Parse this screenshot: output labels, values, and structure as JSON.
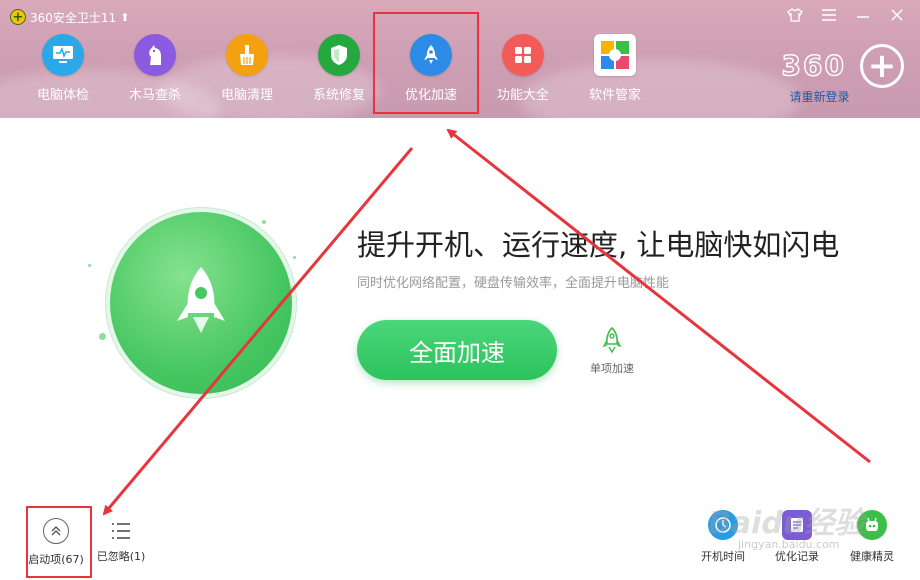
{
  "app": {
    "title": "360安全卫士11",
    "upgrade_icon": "arrow-up-icon"
  },
  "window_controls": [
    {
      "name": "skin",
      "icon": "shirt-icon"
    },
    {
      "name": "menu",
      "icon": "menu-icon"
    },
    {
      "name": "minimize",
      "icon": "minimize-icon"
    },
    {
      "name": "close",
      "icon": "close-icon"
    }
  ],
  "nav": {
    "items": [
      {
        "label": "电脑体检",
        "icon": "monitor-icon",
        "color": "#2aa8e8"
      },
      {
        "label": "木马查杀",
        "icon": "horse-icon",
        "color": "#8a5be0"
      },
      {
        "label": "电脑清理",
        "icon": "broom-icon",
        "color": "#f4a10f"
      },
      {
        "label": "系统修复",
        "icon": "shield-icon",
        "color": "#25a83f"
      },
      {
        "label": "优化加速",
        "icon": "rocket-icon",
        "color": "#2b8be6",
        "active": true
      },
      {
        "label": "功能大全",
        "icon": "grid-icon",
        "color": "#f25b57"
      },
      {
        "label": "软件管家",
        "icon": "flower-icon",
        "color": "#f4b400"
      }
    ]
  },
  "account": {
    "logo": "360",
    "relogin_label": "请重新登录"
  },
  "hero": {
    "title": "提升开机、运行速度, 让电脑快如闪电",
    "subtitle": "同时优化网络配置，硬盘传输效率，全面提升电脑性能",
    "primary_button": "全面加速",
    "single_speed_label": "单项加速"
  },
  "bottom": {
    "startup_label": "启动项(67)",
    "ignored_label": "已忽略(1)",
    "tools": [
      {
        "label": "开机时间",
        "icon": "clock-icon",
        "color": "#2a9be3"
      },
      {
        "label": "优化记录",
        "icon": "record-icon",
        "color": "#7c5cd6"
      },
      {
        "label": "健康精灵",
        "icon": "robot-icon",
        "color": "#3cbf4a"
      }
    ]
  },
  "watermark": {
    "text": "Baidu经验",
    "sub": "jingyan.baidu.com"
  },
  "annotation_color": "#e8343c"
}
